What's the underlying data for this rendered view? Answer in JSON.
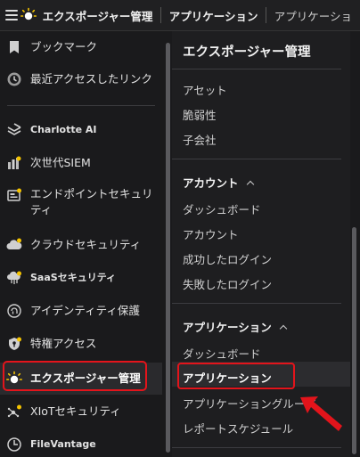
{
  "topbar": {
    "crumb1": "エクスポージャー管理",
    "crumb2": "アプリケーション",
    "crumb3": "アプリケーショ"
  },
  "sidebar": {
    "items": [
      {
        "label": "ブックマーク",
        "icon": "bookmark-icon"
      },
      {
        "label": "最近アクセスしたリンク",
        "icon": "recent-clock-icon"
      },
      {
        "label": "Charlotte AI",
        "icon": "charlotte-ai-icon"
      },
      {
        "label": "次世代SIEM",
        "icon": "siem-icon"
      },
      {
        "label": "エンドポイントセキュリティ",
        "icon": "endpoint-security-icon"
      },
      {
        "label": "クラウドセキュリティ",
        "icon": "cloud-security-icon"
      },
      {
        "label": "SaaSセキュリティ",
        "icon": "saas-security-icon"
      },
      {
        "label": "アイデンティティ保護",
        "icon": "identity-protection-icon"
      },
      {
        "label": "特権アクセス",
        "icon": "privileged-access-icon"
      },
      {
        "label": "エクスポージャー管理",
        "icon": "exposure-management-icon"
      },
      {
        "label": "XIoTセキュリティ",
        "icon": "xiot-security-icon"
      },
      {
        "label": "FileVantage",
        "icon": "filevantage-icon"
      }
    ]
  },
  "panel": {
    "title": "エクスポージャー管理",
    "top_items": [
      "アセット",
      "脆弱性",
      "子会社"
    ],
    "account": {
      "heading": "アカウント",
      "items": [
        "ダッシュボード",
        "アカウント",
        "成功したログイン",
        "失敗したログイン"
      ]
    },
    "application": {
      "heading": "アプリケーション",
      "items": [
        "ダッシュボード",
        "アプリケーション",
        "アプリケーショングループ",
        "レポートスケジュール"
      ]
    }
  },
  "colors": {
    "highlight": "#e3141b",
    "background": "#1a1a1c",
    "panel": "#1e1e20"
  }
}
